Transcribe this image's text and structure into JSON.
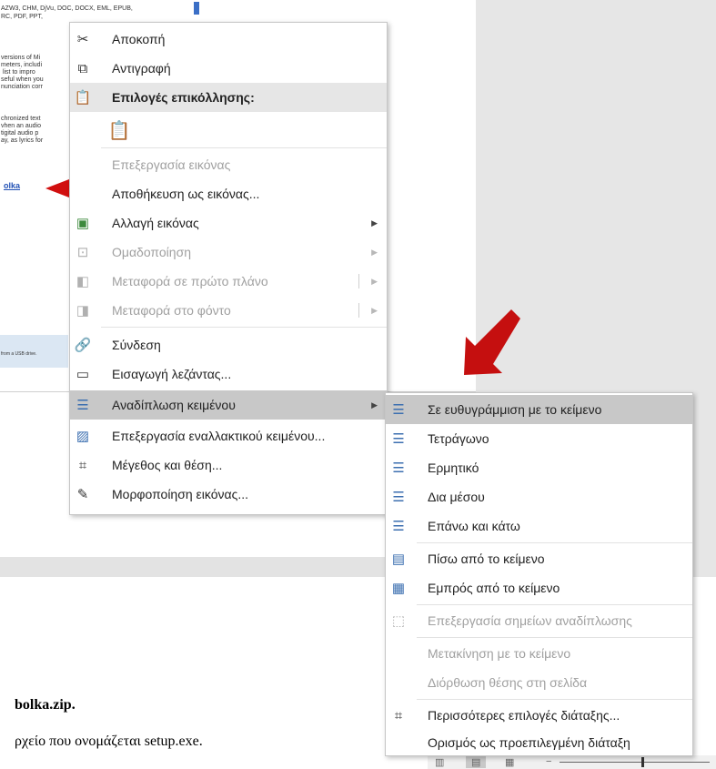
{
  "doc": {
    "fragments": [
      "AZW3, CHM, DjVu, DOC, DOCX, EML, EPUB,",
      "RC, PDF, PPT,",
      "versions of Mi",
      "meters, includi",
      " list to impro",
      "seful when you",
      "nunciation corr",
      "chronized text",
      "vhen an audio",
      "tigital audio p",
      "ay, as lyrics for"
    ],
    "link_text": "olka",
    "usb_text": "from a USB drive.",
    "bottom_line1": "bolka.zip.",
    "bottom_line2": "ρχείο που ονομάζεται setup.exe."
  },
  "context_menu": {
    "items": [
      {
        "label": "Αποκοπή",
        "icon": "scissors-icon"
      },
      {
        "label": "Αντιγραφή",
        "icon": "copy-icon"
      },
      {
        "label": "Επιλογές επικόλλησης:",
        "icon": "paste-icon"
      },
      {
        "label": "",
        "icon": "paste-option-icon"
      },
      {
        "label": "Επεξεργασία εικόνας",
        "icon": ""
      },
      {
        "label": "Αποθήκευση ως εικόνας...",
        "icon": ""
      },
      {
        "label": "Αλλαγή εικόνας",
        "icon": "change-picture-icon"
      },
      {
        "label": "Ομαδοποίηση",
        "icon": "group-icon"
      },
      {
        "label": "Μεταφορά σε πρώτο πλάνο",
        "icon": "bring-forward-icon"
      },
      {
        "label": "Μεταφορά στο φόντο",
        "icon": "send-backward-icon"
      },
      {
        "label": "Σύνδεση",
        "icon": "link-icon"
      },
      {
        "label": "Εισαγωγή λεζάντας...",
        "icon": "caption-icon"
      },
      {
        "label": "Αναδίπλωση κειμένου",
        "icon": "wrap-text-icon"
      },
      {
        "label": "Επεξεργασία εναλλακτικού κειμένου...",
        "icon": "alt-text-icon"
      },
      {
        "label": "Μέγεθος και θέση...",
        "icon": "size-position-icon"
      },
      {
        "label": "Μορφοποίηση εικόνας...",
        "icon": "format-picture-icon"
      }
    ]
  },
  "wrap_submenu": {
    "items": [
      {
        "label": "Σε ευθυγράμμιση με το κείμενο",
        "icon": "inline-wrap-icon"
      },
      {
        "label": "Τετράγωνο",
        "icon": "square-wrap-icon"
      },
      {
        "label": "Ερμητικό",
        "icon": "tight-wrap-icon"
      },
      {
        "label": "Δια μέσου",
        "icon": "through-wrap-icon"
      },
      {
        "label": "Επάνω και κάτω",
        "icon": "top-bottom-wrap-icon"
      },
      {
        "label": "Πίσω από το κείμενο",
        "icon": "behind-text-icon"
      },
      {
        "label": "Εμπρός από το κείμενο",
        "icon": "in-front-text-icon"
      },
      {
        "label": "Επεξεργασία σημείων αναδίπλωσης",
        "icon": "edit-wrap-points-icon"
      },
      {
        "label": "Μετακίνηση με το κείμενο",
        "icon": ""
      },
      {
        "label": "Διόρθωση θέσης στη σελίδα",
        "icon": ""
      },
      {
        "label": "Περισσότερες επιλογές διάταξης...",
        "icon": "more-layout-icon"
      },
      {
        "label": "Ορισμός ως προεπιλεγμένη διάταξη",
        "icon": ""
      }
    ]
  },
  "colors": {
    "accent": "#d10f0f",
    "highlight": "#c8c8c8",
    "icon_blue": "#3c6fb0"
  }
}
